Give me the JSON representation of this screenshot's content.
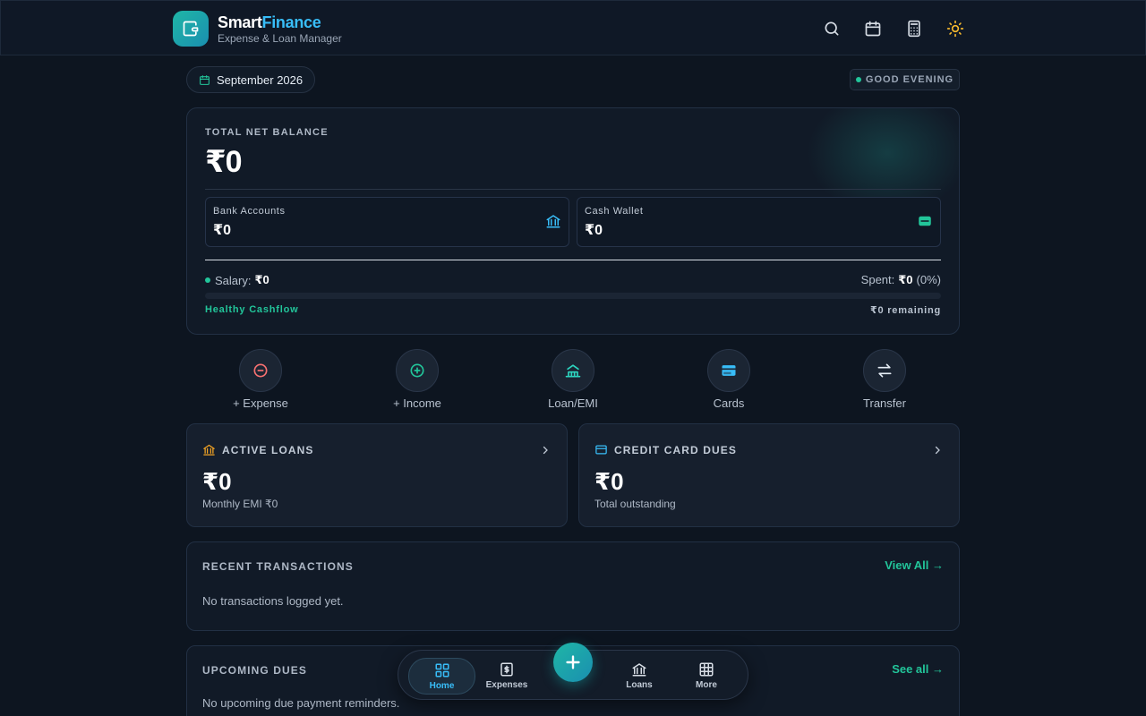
{
  "app": {
    "name_part1": "Smart",
    "name_part2": "Finance",
    "subtitle": "Expense & Loan Manager"
  },
  "header_icons": [
    "search-icon",
    "calendar-icon",
    "calculator-icon",
    "sun-icon"
  ],
  "date": "September 2026",
  "greeting": "GOOD EVENING",
  "balance": {
    "label": "TOTAL NET BALANCE",
    "value": "₹0",
    "bank_label": "Bank Accounts",
    "bank_value": "₹0",
    "cash_label": "Cash Wallet",
    "cash_value": "₹0",
    "salary_label": "Salary:",
    "salary_value": "₹0",
    "spent_label": "Spent:",
    "spent_value": "₹0",
    "spent_pct": "(0%)",
    "progress": 0,
    "status": "Healthy Cashflow",
    "remaining": "₹0 remaining"
  },
  "quick_actions": [
    {
      "label": "+ Expense",
      "icon": "minus-circle-icon"
    },
    {
      "label": "+ Income",
      "icon": "plus-circle-icon"
    },
    {
      "label": "Loan/EMI",
      "icon": "loan-hand-icon"
    },
    {
      "label": "Cards",
      "icon": "card-icon"
    },
    {
      "label": "Transfer",
      "icon": "transfer-icon"
    }
  ],
  "loans_card": {
    "title": "ACTIVE LOANS",
    "value": "₹0",
    "sub": "Monthly EMI ₹0"
  },
  "cc_card": {
    "title": "CREDIT CARD DUES",
    "value": "₹0",
    "sub": "Total outstanding"
  },
  "transactions": {
    "title": "RECENT TRANSACTIONS",
    "link": "View All →",
    "empty": "No transactions logged yet."
  },
  "dues": {
    "title": "UPCOMING DUES",
    "link": "See all →",
    "empty": "No upcoming due payment reminders."
  },
  "nav": [
    {
      "label": "Home",
      "icon": "grid-icon",
      "active": true
    },
    {
      "label": "Expenses",
      "icon": "receipt-icon",
      "active": false
    },
    {
      "label": "Loans",
      "icon": "bank-icon",
      "active": false
    },
    {
      "label": "More",
      "icon": "apps-icon",
      "active": false
    }
  ],
  "colors": {
    "accent_teal": "#22c59a",
    "accent_blue": "#38bdf8",
    "background": "#0d1520"
  }
}
